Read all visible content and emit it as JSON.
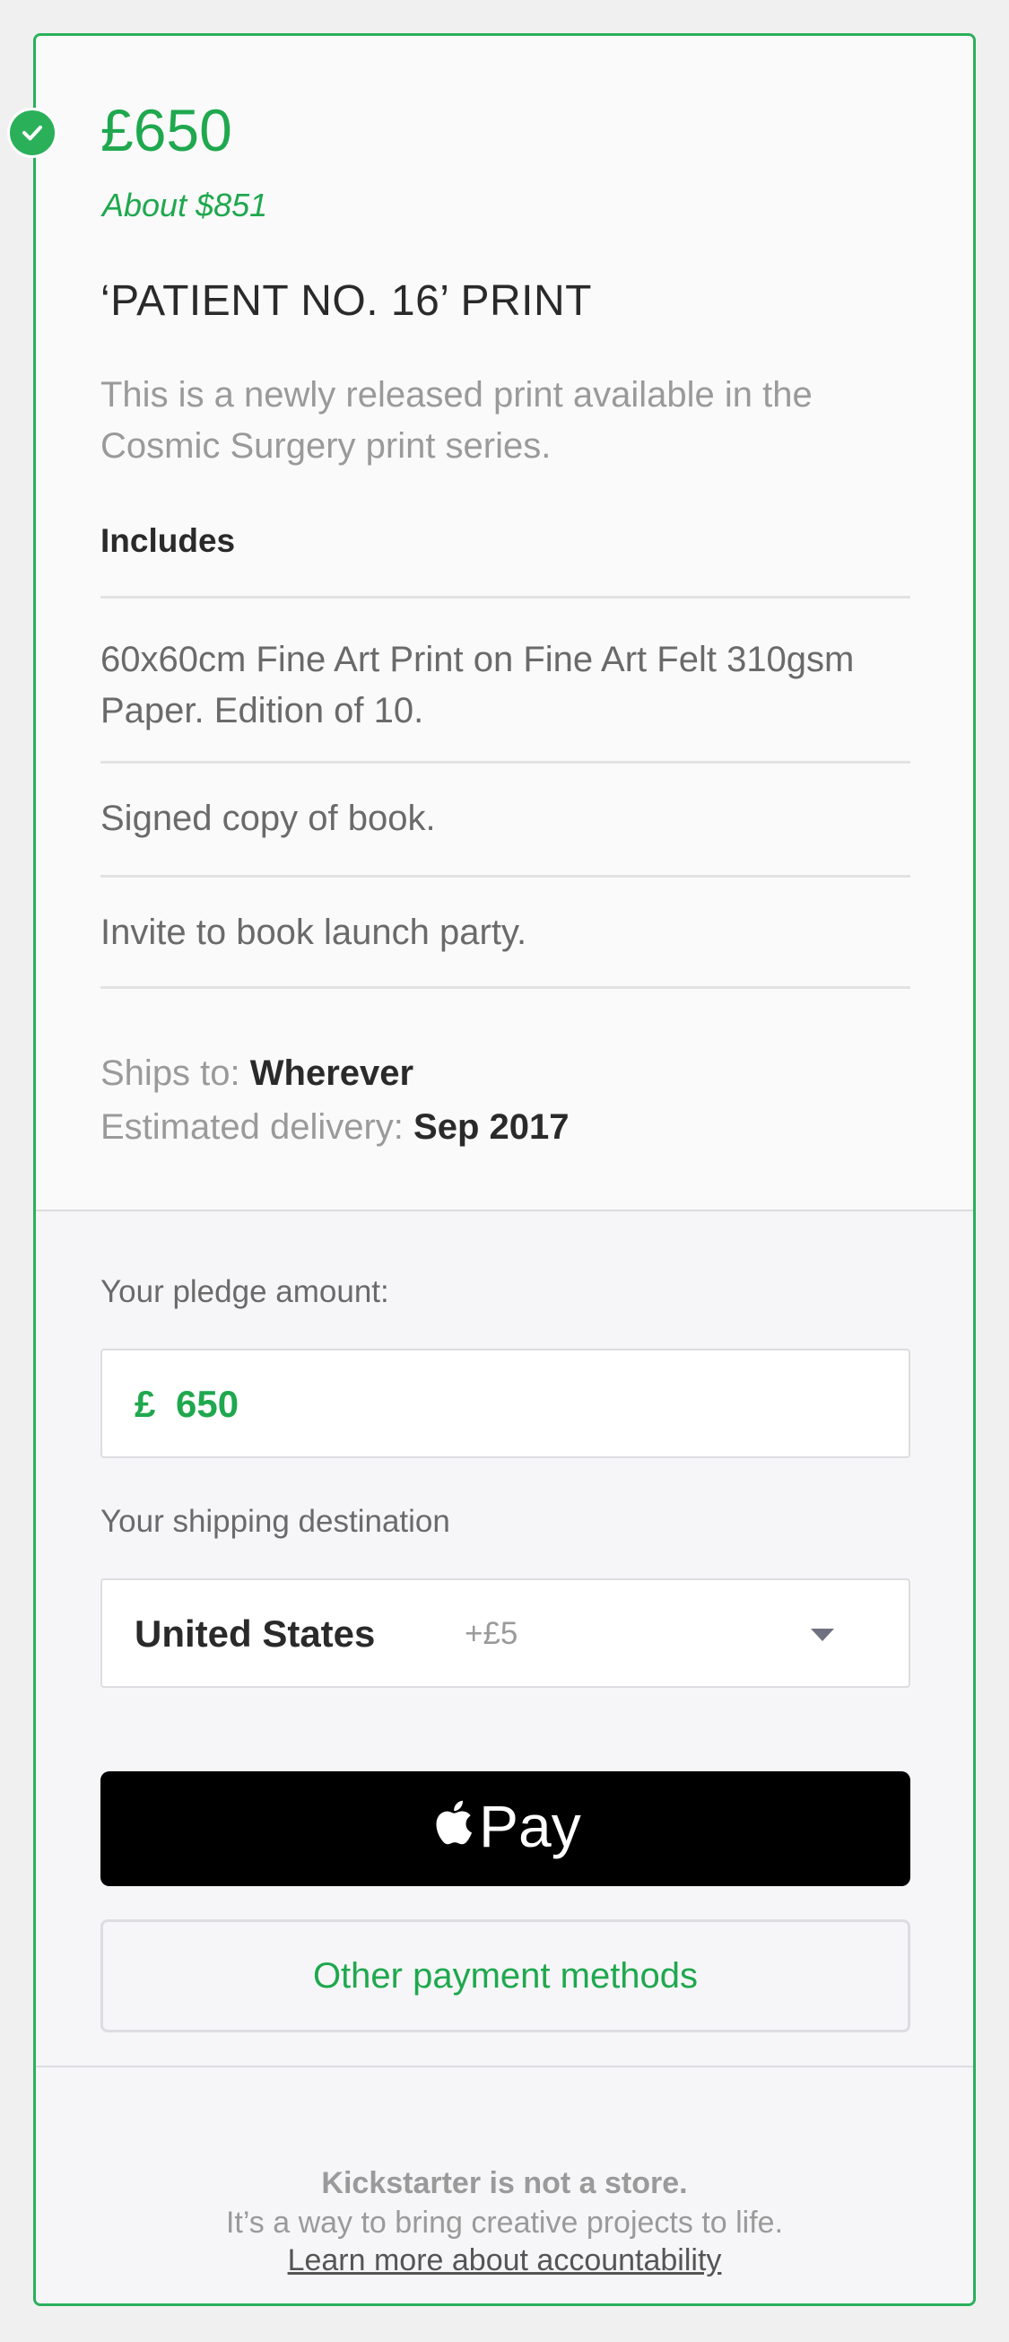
{
  "reward": {
    "price": "£650",
    "converted": "About $851",
    "title": "‘PATIENT NO. 16’ PRINT",
    "description": "This is a newly released print available in the Cosmic Surgery print series.",
    "includes_label": "Includes",
    "items": [
      "60x60cm Fine Art Print on Fine Art Felt 310gsm Paper. Edition of 10.",
      "Signed copy of book.",
      "Invite to book launch party."
    ],
    "ships_to_label": "Ships to:",
    "ships_to_value": "Wherever",
    "delivery_label": "Estimated delivery:",
    "delivery_value": "Sep 2017",
    "selected_icon": "checkmark-circle-icon"
  },
  "pledge": {
    "amount_label": "Your pledge amount:",
    "currency_symbol": "£",
    "amount_value": "650",
    "shipping_label": "Your shipping destination",
    "shipping_country": "United States",
    "shipping_extra": "+£5",
    "apple_pay_label": "Pay",
    "other_payment_label": "Other payment methods"
  },
  "footer": {
    "line1": "Kickstarter is not a store.",
    "line2": "It’s a way to bring creative projects to life.",
    "link": "Learn more about accountability"
  },
  "colors": {
    "accent_green": "#1fa84e",
    "border_green": "#2bb05a"
  }
}
